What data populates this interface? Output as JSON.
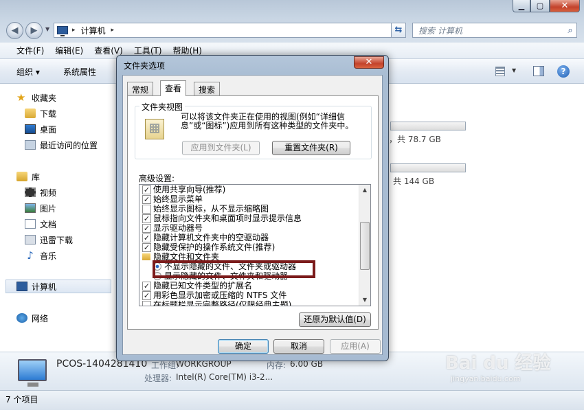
{
  "address": {
    "path": "计算机"
  },
  "search": {
    "placeholder": "搜索 计算机"
  },
  "menu": [
    "文件(F)",
    "编辑(E)",
    "查看(V)",
    "工具(T)",
    "帮助(H)"
  ],
  "command": {
    "organize": "组织 ▾",
    "system_properties": "系统属性"
  },
  "sidebar": {
    "favorites": "收藏夹",
    "downloads": "下载",
    "desktop": "桌面",
    "recent": "最近访问的位置",
    "libraries": "库",
    "videos": "视频",
    "pictures": "图片",
    "documents": "文档",
    "thunder": "迅雷下载",
    "music": "音乐",
    "computer": "计算机",
    "network": "网络"
  },
  "drives": [
    {
      "space": "，共 78.7 GB"
    },
    {
      "space": "共 144 GB"
    }
  ],
  "details": {
    "name": "PCOS-1404281410",
    "workgroup_label": "工作组:",
    "workgroup": "WORKGROUP",
    "memory_label": "内存:",
    "memory": "6.00 GB",
    "cpu_label": "处理器:",
    "cpu": "Intel(R) Core(TM) i3-2..."
  },
  "status": {
    "items": "7 个项目"
  },
  "watermark": {
    "logo": "Bai du 经验",
    "url": "jingyan.baidu.com"
  },
  "dialog": {
    "title": "文件夹选项",
    "tabs": [
      "常规",
      "查看",
      "搜索"
    ],
    "folder_views": {
      "legend": "文件夹视图",
      "description": "可以将该文件夹正在使用的视图(例如“详细信息”或“图标”)应用到所有这种类型的文件夹中。",
      "apply_button": "应用到文件夹(L)",
      "reset_button": "重置文件夹(R)"
    },
    "advanced_label": "高级设置:",
    "settings": [
      {
        "label": "使用共享向导(推荐)",
        "type": "checkbox",
        "checked": true
      },
      {
        "label": "始终显示菜单",
        "type": "checkbox",
        "checked": true
      },
      {
        "label": "始终显示图标，从不显示缩略图",
        "type": "checkbox",
        "checked": false
      },
      {
        "label": "鼠标指向文件夹和桌面项时显示提示信息",
        "type": "checkbox",
        "checked": true
      },
      {
        "label": "显示驱动器号",
        "type": "checkbox",
        "checked": true
      },
      {
        "label": "隐藏计算机文件夹中的空驱动器",
        "type": "checkbox",
        "checked": true
      },
      {
        "label": "隐藏受保护的操作系统文件(推荐)",
        "type": "checkbox",
        "checked": true
      },
      {
        "label": "隐藏文件和文件夹",
        "type": "folder"
      },
      {
        "label": "不显示隐藏的文件、文件夹或驱动器",
        "type": "radio",
        "checked": true
      },
      {
        "label": "显示隐藏的文件、文件夹和驱动器",
        "type": "radio",
        "checked": false
      },
      {
        "label": "隐藏已知文件类型的扩展名",
        "type": "checkbox",
        "checked": true
      },
      {
        "label": "用彩色显示加密或压缩的 NTFS 文件",
        "type": "checkbox",
        "checked": true
      },
      {
        "label": "在标题栏显示完整路径(仅限经典主题)",
        "type": "checkbox",
        "checked": false
      }
    ],
    "restore_defaults": "还原为默认值(D)",
    "ok": "确定",
    "cancel": "取消",
    "apply": "应用(A)"
  }
}
